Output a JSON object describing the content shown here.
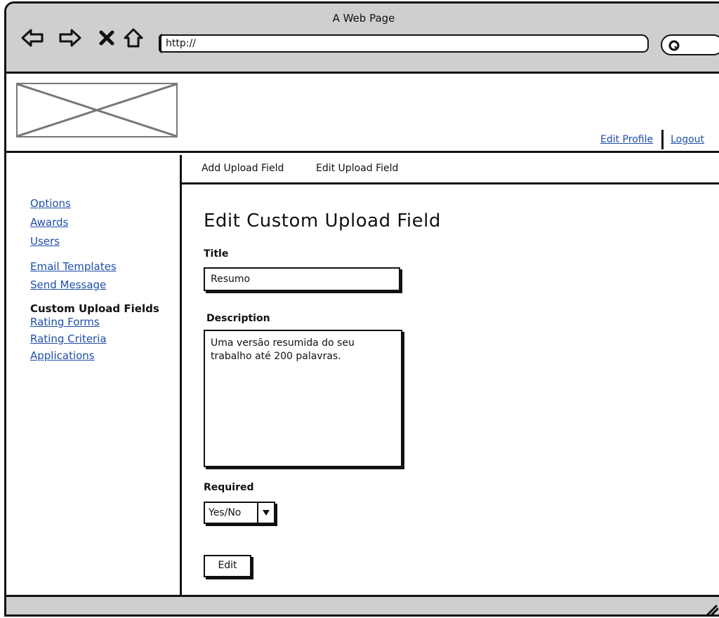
{
  "window": {
    "title": "A Web Page"
  },
  "browser": {
    "address": "http://",
    "icons": [
      "back-arrow-icon",
      "forward-arrow-icon",
      "stop-icon",
      "home-icon",
      "search-icon"
    ]
  },
  "header": {
    "logo": "image-placeholder",
    "links": {
      "edit_profile": "Edit Profile",
      "logout": "Logout"
    }
  },
  "sidebar": {
    "items": [
      {
        "label": "Options"
      },
      {
        "label": "Awards"
      },
      {
        "label": "Users"
      },
      {
        "label": "Email Templates"
      },
      {
        "label": "Send Message"
      },
      {
        "label": "Custom Upload Fields",
        "current": true
      },
      {
        "label": "Rating Forms"
      },
      {
        "label": "Rating Criteria"
      },
      {
        "label": "Applications"
      }
    ]
  },
  "tabs": [
    {
      "label": "Add Upload Field"
    },
    {
      "label": "Edit Upload Field"
    }
  ],
  "form": {
    "heading": "Edit Custom Upload Field",
    "title_label": "Title",
    "title_value": "Resumo",
    "description_label": "Description",
    "description_value": "Uma versão resumida do seu\ntrabalho até 200 palavras.",
    "required_label": "Required",
    "required_value": "Yes/No",
    "submit_label": "Edit"
  }
}
